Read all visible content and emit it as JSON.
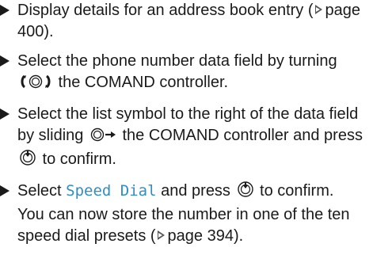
{
  "steps": [
    {
      "text_before": "Display details for an address book entry (",
      "ref_text": "page 400).",
      "text_after": ""
    },
    {
      "text_before": "Select the phone number data field by turning ",
      "control_icon": "rotate-controller-icon",
      "text_after": " the COMAND controller."
    },
    {
      "text_before": "Select the list symbol to the right of the data field by sliding ",
      "control_icon": "slide-right-controller-icon",
      "text_mid": " the COMAND controller and press ",
      "confirm_icon": "press-controller-icon",
      "text_after": " to confirm."
    },
    {
      "text_before": "Select ",
      "menu_term": "Speed Dial",
      "text_mid": " and press ",
      "confirm_icon": "press-controller-icon",
      "text_after": " to confirm.",
      "result_before": "You can now store the number in one of the ten speed dial presets (",
      "result_ref": "page 394)."
    }
  ],
  "colors": {
    "text": "#1a1a1a",
    "menu_term": "#2e8fc8"
  }
}
